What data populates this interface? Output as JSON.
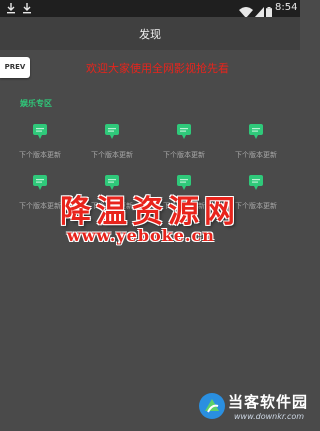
{
  "status_bar": {
    "time": "8:54"
  },
  "header": {
    "title": "发现"
  },
  "prev_button": {
    "label": "PREV"
  },
  "marquee": {
    "text": "欢迎大家使用全网影视抢先看"
  },
  "section": {
    "title": "娱乐专区",
    "items": [
      {
        "label": "下个版本更新"
      },
      {
        "label": "下个版本更新"
      },
      {
        "label": "下个版本更新"
      },
      {
        "label": "下个版本更新"
      },
      {
        "label": "下个版本更新"
      },
      {
        "label": "下个版本更新"
      },
      {
        "label": "下个版本更新"
      },
      {
        "label": "下个版本更新"
      }
    ]
  },
  "watermark": {
    "text": "降温资源网",
    "url": "www.yeboke.cn"
  },
  "brand": {
    "name": "当客软件园",
    "url": "www.downkr.com"
  },
  "colors": {
    "accent_green": "#2fc97a",
    "marquee_red": "#e8241c",
    "background": "#4a4a4a",
    "header": "#404040"
  }
}
